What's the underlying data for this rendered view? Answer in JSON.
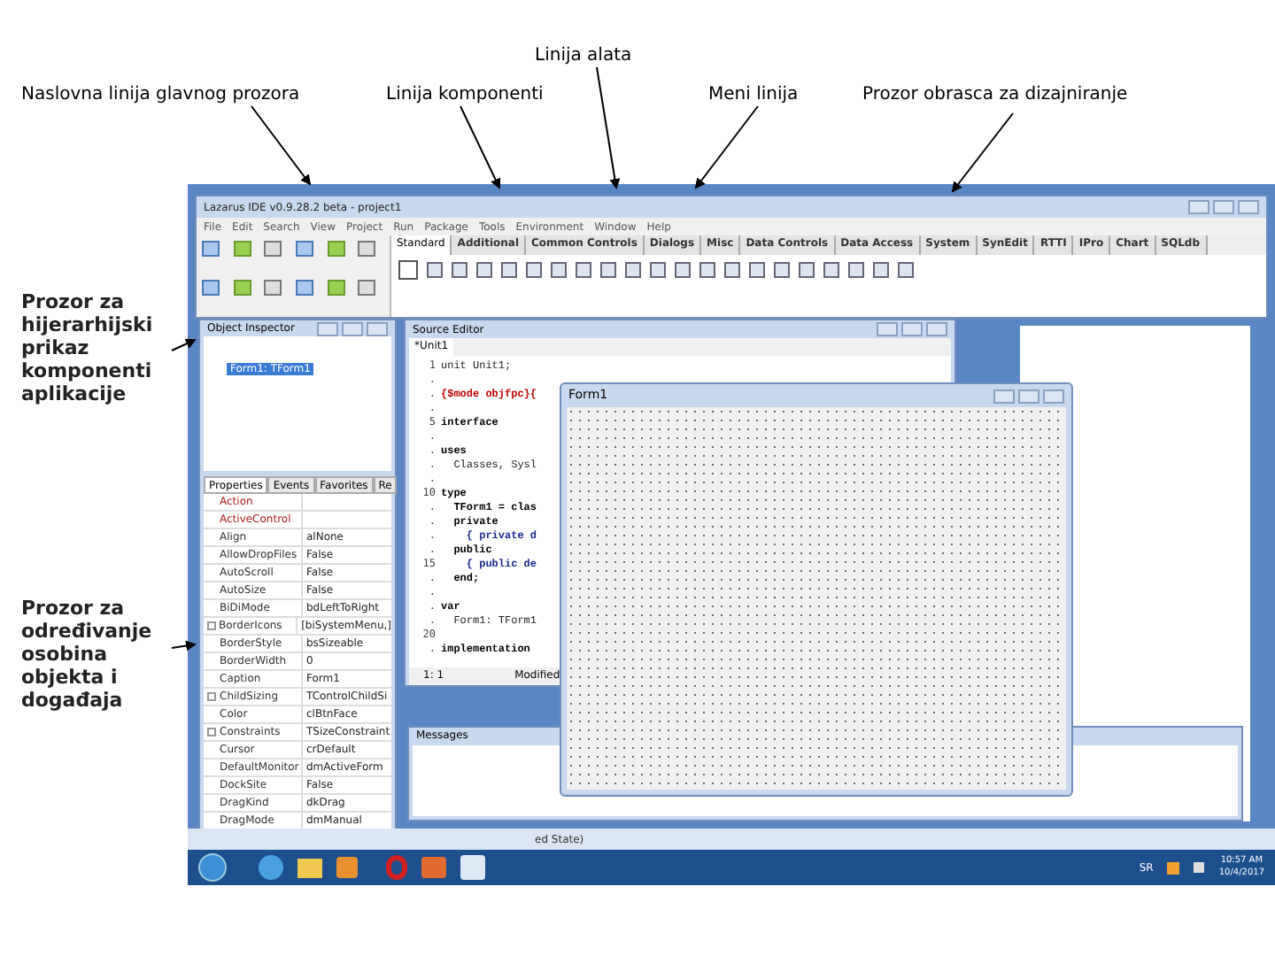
{
  "annotations_top": [
    "Linija alata",
    "Naslovna linija glavnog prozora",
    "Linija komponenti",
    "Meni linija",
    "Prozor obrasca za dizajniranje"
  ],
  "annotations_left": [
    "Prozor za hijerarhijski prikaz komponenti aplikacije",
    "Prozor za određivanje osobina objekta i događaja"
  ],
  "main_window": {
    "title": "Lazarus IDE v0.9.28.2 beta - project1",
    "menu": [
      "File",
      "Edit",
      "Search",
      "View",
      "Project",
      "Run",
      "Package",
      "Tools",
      "Environment",
      "Window",
      "Help"
    ],
    "component_tabs": [
      {
        "label": "Standard",
        "selected": true
      },
      {
        "label": "Additional",
        "selected": false
      },
      {
        "label": "Common Controls",
        "selected": false
      },
      {
        "label": "Dialogs",
        "selected": false
      },
      {
        "label": "Misc",
        "selected": false
      },
      {
        "label": "Data Controls",
        "selected": false
      },
      {
        "label": "Data Access",
        "selected": false
      },
      {
        "label": "System",
        "selected": false
      },
      {
        "label": "SynEdit",
        "selected": false
      },
      {
        "label": "RTTI",
        "selected": false
      },
      {
        "label": "IPro",
        "selected": false
      },
      {
        "label": "Chart",
        "selected": false
      },
      {
        "label": "SQLdb",
        "selected": false
      }
    ]
  },
  "object_inspector": {
    "title": "Object Inspector",
    "tree_item": "Form1: TForm1",
    "tabs": [
      {
        "label": "Properties",
        "selected": true
      },
      {
        "label": "Events",
        "selected": false
      },
      {
        "label": "Favorites",
        "selected": false
      },
      {
        "label": "Re",
        "selected": false
      }
    ],
    "properties": [
      {
        "name": "Action",
        "highlighted": true,
        "expandable": false
      },
      {
        "name": "ActiveControl",
        "highlighted": true,
        "expandable": false
      },
      {
        "name": "Align",
        "value": "alNone",
        "highlighted": false,
        "expandable": false
      },
      {
        "name": "AllowDropFiles",
        "value": "False",
        "highlighted": false,
        "expandable": false
      },
      {
        "name": "AutoScroll",
        "value": "False",
        "highlighted": false,
        "expandable": false
      },
      {
        "name": "AutoSize",
        "value": "False",
        "highlighted": false,
        "expandable": false
      },
      {
        "name": "BiDiMode",
        "value": "bdLeftToRight",
        "highlighted": false,
        "expandable": false
      },
      {
        "name": "BorderIcons",
        "value": "[biSystemMenu,]",
        "highlighted": false,
        "expandable": true
      },
      {
        "name": "BorderStyle",
        "value": "bsSizeable",
        "highlighted": false,
        "expandable": false
      },
      {
        "name": "BorderWidth",
        "value": "0",
        "highlighted": false,
        "expandable": false
      },
      {
        "name": "Caption",
        "value": "Form1",
        "highlighted": false,
        "expandable": false
      },
      {
        "name": "ChildSizing",
        "value": "TControlChildSi",
        "highlighted": false,
        "expandable": true
      },
      {
        "name": "Color",
        "value": "clBtnFace",
        "highlighted": false,
        "expandable": false
      },
      {
        "name": "Constraints",
        "value": "TSizeConstraint",
        "highlighted": false,
        "expandable": true
      },
      {
        "name": "Cursor",
        "value": "crDefault",
        "highlighted": false,
        "expandable": false
      },
      {
        "name": "DefaultMonitor",
        "value": "dmActiveForm",
        "highlighted": false,
        "expandable": false
      },
      {
        "name": "DockSite",
        "value": "False",
        "highlighted": false,
        "expandable": false
      },
      {
        "name": "DragKind",
        "value": "dkDrag",
        "highlighted": false,
        "expandable": false
      },
      {
        "name": "DragMode",
        "value": "dmManual",
        "highlighted": false,
        "expandable": false
      }
    ]
  },
  "source_editor": {
    "title": "Source Editor",
    "tab": "*Unit1",
    "lines": [
      {
        "number": "1",
        "text": "unit Unit1;",
        "kind": "plain"
      },
      {
        "number": "."
      },
      {
        "number": ".",
        "text": "{$mode objfpc}{",
        "kind": "directive"
      },
      {
        "number": "."
      },
      {
        "number": "5",
        "text": "interface",
        "kind": "keyword"
      },
      {
        "number": "."
      },
      {
        "number": ".",
        "text": "uses",
        "kind": "keyword"
      },
      {
        "number": ".",
        "text": "  Classes, Sysl",
        "kind": "plain"
      },
      {
        "number": "."
      },
      {
        "number": "10",
        "text": "type",
        "kind": "keyword"
      },
      {
        "number": ".",
        "text": "  TForm1 = clas",
        "kind": "keyword"
      },
      {
        "number": ".",
        "text": "  private",
        "kind": "keyword"
      },
      {
        "number": ".",
        "text": "    { private d",
        "kind": "comment"
      },
      {
        "number": ".",
        "text": "  public",
        "kind": "keyword"
      },
      {
        "number": "15",
        "text": "    { public de",
        "kind": "comment"
      },
      {
        "number": ".",
        "text": "  end;",
        "kind": "keyword"
      },
      {
        "number": "."
      },
      {
        "number": ".",
        "text": "var",
        "kind": "keyword"
      },
      {
        "number": ".",
        "text": "  Form1: TForm1",
        "kind": "plain"
      },
      {
        "number": "20"
      },
      {
        "number": ".",
        "text": "implementation",
        "kind": "keyword"
      }
    ],
    "status": [
      "1: 1",
      "Modified"
    ]
  },
  "form_window": {
    "title": "Form1"
  },
  "messages": {
    "title": "Messages"
  },
  "status_fragment": "ed State)",
  "taskbar": {
    "language": "SR",
    "time": "10:57 AM",
    "date": "10/4/2017"
  }
}
